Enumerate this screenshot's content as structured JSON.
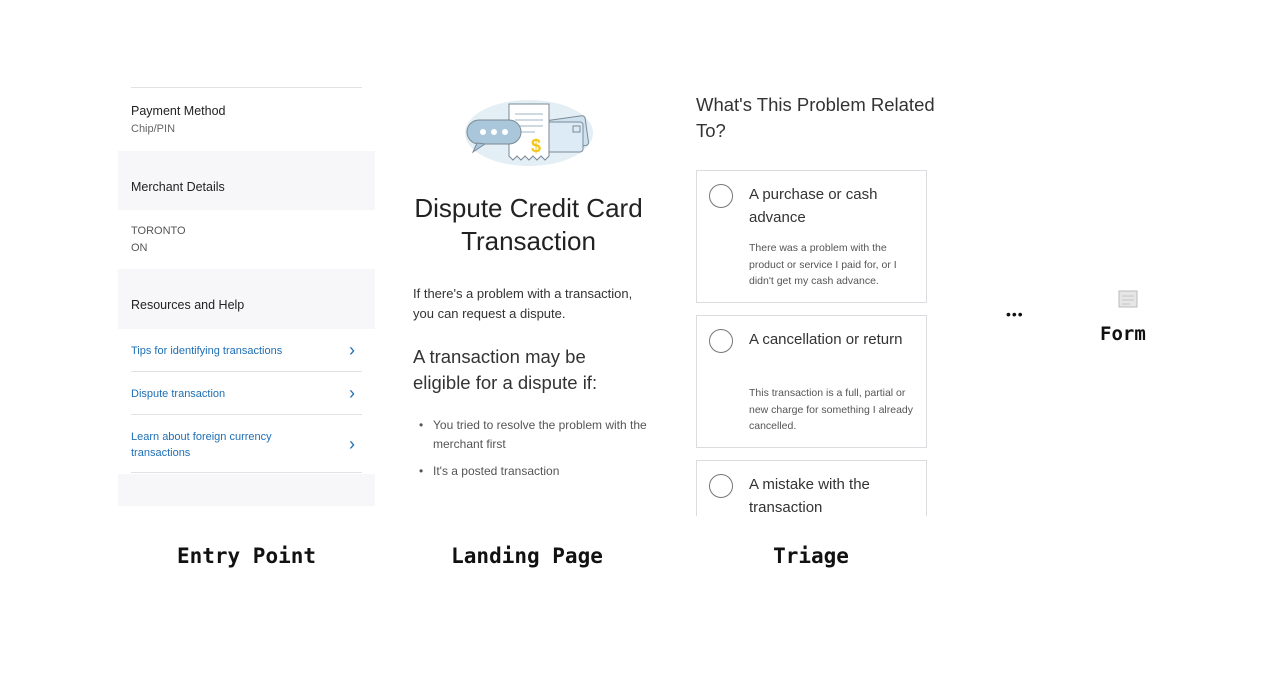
{
  "entry_point": {
    "payment_method_title": "Payment Method",
    "payment_method_value": "Chip/PIN",
    "merchant_details_title": "Merchant Details",
    "merchant_city": "TORONTO",
    "merchant_province": "ON",
    "resources_title": "Resources and Help",
    "links": [
      {
        "label": "Tips for identifying transactions"
      },
      {
        "label": "Dispute transaction"
      },
      {
        "label": "Learn about foreign currency transactions"
      }
    ]
  },
  "landing_page": {
    "illustration_symbol": "$",
    "title": "Dispute Credit Card Transaction",
    "intro": "If there's a problem with a transaction, you can request a dispute.",
    "eligibility_heading": "A transaction may be eligible for a dispute if:",
    "bullets": [
      "You tried to resolve the problem with the merchant first",
      "It's a posted transaction"
    ]
  },
  "triage": {
    "title": "What's This Problem Related To?",
    "options": [
      {
        "label": "A purchase or cash advance",
        "description": "There was a problem with the product or service I paid for, or I didn't get my cash advance."
      },
      {
        "label": "A cancellation or return",
        "description": "This transaction is a full, partial or new charge for something I already cancelled."
      },
      {
        "label": "A mistake with the transaction",
        "description": ""
      }
    ]
  },
  "captions": {
    "entry_point": "Entry Point",
    "landing_page": "Landing Page",
    "triage": "Triage",
    "ellipsis": "•••",
    "form": "Form"
  },
  "colors": {
    "link_blue": "#1e6fb5",
    "illustration_blue": "#c5dbe9",
    "dollar_yellow": "#f5c518"
  }
}
